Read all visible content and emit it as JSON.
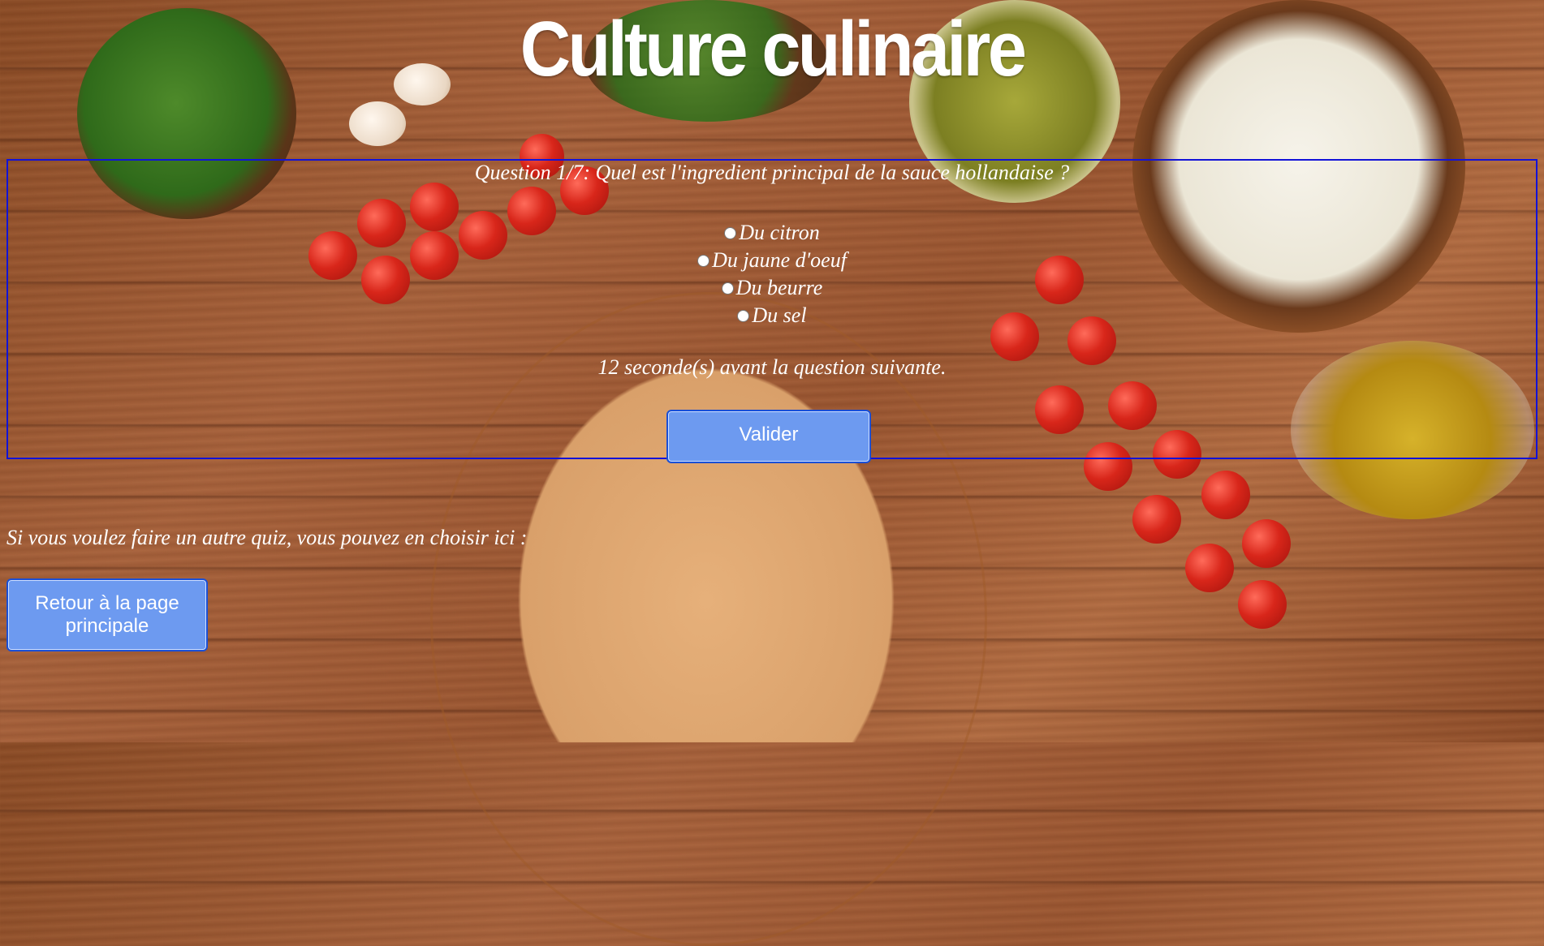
{
  "title": "Culture culinaire",
  "quiz": {
    "question": "Question 1/7: Quel est l'ingredient principal de la sauce hollandaise ?",
    "answers": [
      "Du citron",
      "Du jaune d'oeuf",
      "Du beurre",
      "Du sel"
    ],
    "timer_text": "12 seconde(s) avant la question suivante.",
    "validate_label": "Valider"
  },
  "footer": {
    "other_quiz_text": "Si vous voulez faire un autre quiz, vous pouvez en choisir ici :",
    "home_button_label": "Retour à la page principale"
  },
  "colors": {
    "button_bg": "#6d9af0",
    "button_border": "#1a4fd6",
    "box_border": "#1212d8"
  }
}
